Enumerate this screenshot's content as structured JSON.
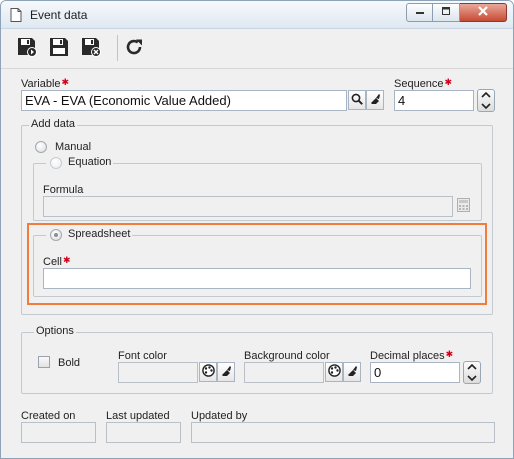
{
  "window": {
    "title": "Event data"
  },
  "toolbar": {
    "save_new_tooltip": "Save and new",
    "save_tooltip": "Save",
    "save_close_tooltip": "Save and close",
    "refresh_tooltip": "Refresh"
  },
  "variable": {
    "label": "Variable",
    "value": "EVA - EVA (Economic Value Added)"
  },
  "sequence": {
    "label": "Sequence",
    "value": "4"
  },
  "add_data": {
    "legend": "Add data",
    "manual_label": "Manual",
    "equation_label": "Equation",
    "formula_label": "Formula",
    "formula_value": "",
    "spreadsheet_label": "Spreadsheet",
    "cell_label": "Cell",
    "cell_value": ""
  },
  "options": {
    "legend": "Options",
    "bold_label": "Bold",
    "font_color_label": "Font color",
    "background_color_label": "Background color",
    "decimal_places_label": "Decimal places",
    "decimal_places_value": "0"
  },
  "audit": {
    "created_on_label": "Created on",
    "last_updated_label": "Last updated",
    "updated_by_label": "Updated by"
  },
  "colors": {
    "required": "#d0021b",
    "highlight": "#f07d3c",
    "close_button": "#c74a33"
  }
}
